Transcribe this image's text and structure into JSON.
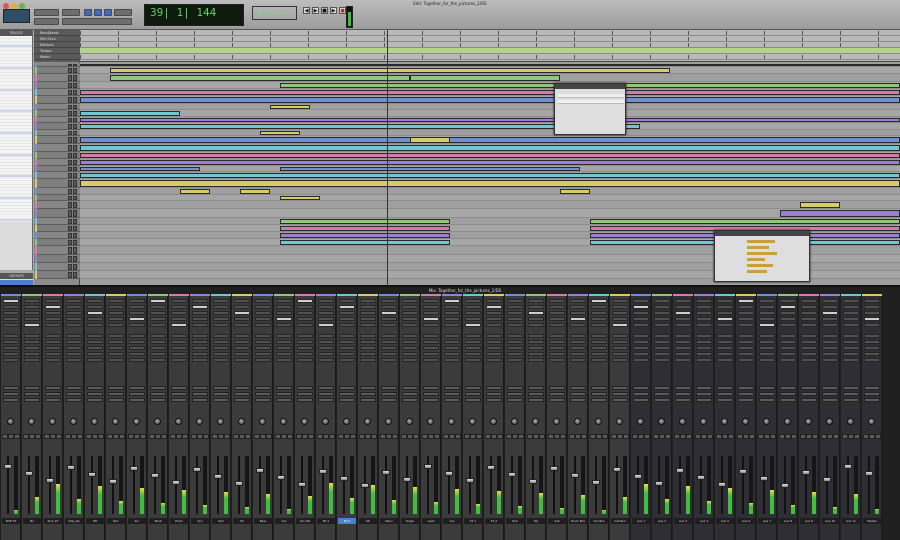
{
  "window": {
    "title": "Edit: Together_for_the_pictures_2/DS"
  },
  "mix_window": {
    "title": "Mix: Together_for_the_pictures_2/DS"
  },
  "transport": {
    "main_counter": "39| 1| 144",
    "mini_counter": "00:00:00",
    "buttons": [
      "rewind",
      "fast-forward",
      "stop",
      "play",
      "record"
    ]
  },
  "panels": {
    "tracks_header": "TRACKS",
    "groups_header": "GROUPS"
  },
  "rulers": [
    "Bars|Beats",
    "Min:Secs",
    "Markers",
    "Tempo",
    "Meter"
  ],
  "colors": {
    "clip_blue": "#6f8fd0",
    "clip_green": "#8fc87a",
    "clip_pink": "#d87aa8",
    "clip_purple": "#9a7fd6",
    "clip_cyan": "#6fc7d0",
    "clip_yellow": "#d6cc6a",
    "meter_green": "#3fbf3f",
    "selected_blue": "#4e7fcf"
  },
  "mixer": {
    "strips": [
      {
        "name": "RHD ST",
        "color": "#6f8fd0"
      },
      {
        "name": "Bs",
        "color": "#8fc87a"
      },
      {
        "name": "Kick_ST",
        "color": "#d87aa8"
      },
      {
        "name": "Clap_Op",
        "color": "#9a7fd6"
      },
      {
        "name": "HH",
        "color": "#6fc7d0"
      },
      {
        "name": "Perc",
        "color": "#d6cc6a"
      },
      {
        "name": "Snr",
        "color": "#6f8fd0"
      },
      {
        "name": "Tamb",
        "color": "#8fc87a"
      },
      {
        "name": "Pluck",
        "color": "#d87aa8"
      },
      {
        "name": "Syn",
        "color": "#9a7fd6"
      },
      {
        "name": "Pad",
        "color": "#6fc7d0"
      },
      {
        "name": "Str",
        "color": "#d6cc6a"
      },
      {
        "name": "Bass",
        "color": "#6f8fd0"
      },
      {
        "name": "Vox",
        "color": "#8fc87a"
      },
      {
        "name": "Vox Dbl",
        "color": "#d87aa8"
      },
      {
        "name": "BV 1",
        "color": "#9a7fd6"
      },
      {
        "name": "BV 2",
        "color": "#6fc7d0"
      },
      {
        "name": "Gtr",
        "color": "#d6cc6a"
      },
      {
        "name": "Piano",
        "color": "#6f8fd0"
      },
      {
        "name": "Organ",
        "color": "#8fc87a"
      },
      {
        "name": "Lead",
        "color": "#d87aa8"
      },
      {
        "name": "Arp",
        "color": "#9a7fd6"
      },
      {
        "name": "FX 1",
        "color": "#6fc7d0"
      },
      {
        "name": "FX 2",
        "color": "#d6cc6a"
      },
      {
        "name": "Rvb",
        "color": "#6f8fd0"
      },
      {
        "name": "Dly",
        "color": "#8fc87a"
      },
      {
        "name": "Sub",
        "color": "#d87aa8"
      },
      {
        "name": "Drum Bus",
        "color": "#9a7fd6"
      },
      {
        "name": "Vox Bus",
        "color": "#6fc7d0"
      },
      {
        "name": "Inst Bus",
        "color": "#d6cc6a"
      },
      {
        "name": "Aux 1",
        "color": "#6f8fd0"
      },
      {
        "name": "Aux 2",
        "color": "#8fc87a"
      },
      {
        "name": "Aux 3",
        "color": "#d87aa8"
      },
      {
        "name": "Aux 4",
        "color": "#9a7fd6"
      },
      {
        "name": "Aux 5",
        "color": "#6fc7d0"
      },
      {
        "name": "Aux 6",
        "color": "#d6cc6a"
      },
      {
        "name": "Aux 7",
        "color": "#6f8fd0"
      },
      {
        "name": "Aux 8",
        "color": "#8fc87a"
      },
      {
        "name": "Aux 9",
        "color": "#d87aa8"
      },
      {
        "name": "Aux 10",
        "color": "#9a7fd6"
      },
      {
        "name": "Aux 11",
        "color": "#6fc7d0"
      },
      {
        "name": "Master",
        "color": "#d6cc6a"
      }
    ],
    "selected_strip": "BV 2"
  }
}
